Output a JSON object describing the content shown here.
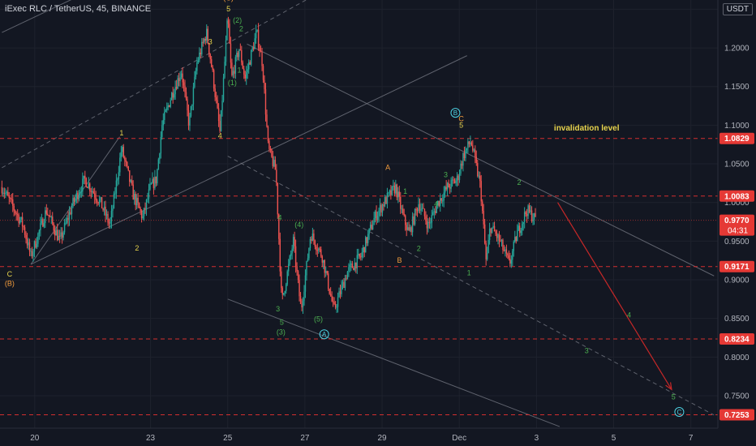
{
  "header": {
    "title": "iExec RLC / TetherUS, 45, BINANCE",
    "currency": "USDT"
  },
  "colors": {
    "background": "#131722",
    "grid": "#1e222d",
    "candle_up": "#26a69a",
    "candle_down": "#ef5350",
    "level_line": "#d32f2f",
    "price_badge": "#e53935",
    "channel_line": "#787b86",
    "arrow": "#c62828",
    "label_orange": "#f39c3d",
    "label_yellow": "#e8d44d",
    "label_green": "#4caf50",
    "label_cyan": "#4dd0e1"
  },
  "chart_data": {
    "type": "candlestick",
    "symbol": "iExec RLC / TetherUS",
    "interval": "45",
    "exchange": "BINANCE",
    "ylim": [
      0.708,
      1.262
    ],
    "y_ticks": [
      1.25,
      1.2,
      1.15,
      1.1,
      1.05,
      1.0,
      0.95,
      0.9,
      0.85,
      0.8,
      0.75
    ],
    "y_tick_labels": [
      "1.2500",
      "1.2000",
      "1.1500",
      "1.1000",
      "1.0500",
      "1.0000",
      "0.9500",
      "0.9000",
      "0.8500",
      "0.8000",
      "0.7500"
    ],
    "x_range_days": [
      -0.9,
      7.7
    ],
    "x_ticks": [
      {
        "day": 0,
        "label": "20"
      },
      {
        "day": 3,
        "label": "23"
      },
      {
        "day": 5,
        "label": "25"
      },
      {
        "day": 7,
        "label": "27"
      },
      {
        "day": 9,
        "label": "29"
      },
      {
        "day": 11,
        "label": "Dec"
      },
      {
        "day": 13,
        "label": "3"
      },
      {
        "day": 15,
        "label": "5"
      },
      {
        "day": 17,
        "label": "7"
      }
    ],
    "price_path": [
      [
        -0.85,
        1.02
      ],
      [
        -0.3,
        0.97
      ],
      [
        -0.1,
        0.93
      ],
      [
        0.3,
        0.99
      ],
      [
        0.65,
        0.95
      ],
      [
        1.0,
        1.0
      ],
      [
        1.3,
        1.03
      ],
      [
        1.7,
        1.0
      ],
      [
        1.95,
        0.97
      ],
      [
        2.25,
        1.07
      ],
      [
        2.55,
        1.01
      ],
      [
        2.8,
        0.98
      ],
      [
        3.0,
        1.02
      ],
      [
        3.15,
        1.03
      ],
      [
        3.3,
        1.1
      ],
      [
        3.55,
        1.14
      ],
      [
        3.8,
        1.17
      ],
      [
        4.0,
        1.1
      ],
      [
        4.2,
        1.18
      ],
      [
        4.45,
        1.22
      ],
      [
        4.6,
        1.17
      ],
      [
        4.8,
        1.09
      ],
      [
        5.0,
        1.24
      ],
      [
        5.1,
        1.16
      ],
      [
        5.3,
        1.2
      ],
      [
        5.45,
        1.16
      ],
      [
        5.75,
        1.22
      ],
      [
        5.9,
        1.18
      ],
      [
        6.05,
        1.07
      ],
      [
        6.25,
        1.04
      ],
      [
        6.4,
        0.87
      ],
      [
        6.7,
        0.95
      ],
      [
        6.9,
        0.86
      ],
      [
        7.15,
        0.96
      ],
      [
        7.45,
        0.93
      ],
      [
        7.75,
        0.86
      ],
      [
        8.1,
        0.91
      ],
      [
        8.45,
        0.93
      ],
      [
        8.8,
        0.98
      ],
      [
        9.05,
        1.0
      ],
      [
        9.35,
        1.02
      ],
      [
        9.55,
        0.98
      ],
      [
        9.7,
        0.96
      ],
      [
        9.95,
        1.0
      ],
      [
        10.2,
        0.97
      ],
      [
        10.45,
        1.0
      ],
      [
        10.7,
        1.02
      ],
      [
        10.95,
        1.03
      ],
      [
        11.1,
        1.06
      ],
      [
        11.3,
        1.08
      ],
      [
        11.55,
        1.02
      ],
      [
        11.7,
        0.92
      ],
      [
        11.8,
        0.97
      ],
      [
        12.05,
        0.95
      ],
      [
        12.3,
        0.92
      ],
      [
        12.5,
        0.96
      ],
      [
        12.75,
        0.99
      ],
      [
        13.0,
        0.977
      ]
    ],
    "current_price": {
      "value": 0.977,
      "label": "0.9770",
      "countdown": "04:31"
    },
    "levels": [
      {
        "value": 1.0829,
        "label": "1.0829"
      },
      {
        "value": 1.0083,
        "label": "1.0083"
      },
      {
        "value": 0.9171,
        "label": "0.9171"
      },
      {
        "value": 0.8234,
        "label": "0.8234"
      },
      {
        "value": 0.7253,
        "label": "0.7253"
      }
    ],
    "annotations": [
      {
        "text": "invalidation level",
        "day": 14.3,
        "price": 1.093,
        "color": "label_yellow",
        "bold": true
      },
      {
        "text": "(C)",
        "day": 5.02,
        "price": 1.2615,
        "color": "label_orange"
      },
      {
        "text": "5",
        "day": 5.02,
        "price": 1.2475,
        "color": "label_yellow"
      },
      {
        "text": "3",
        "day": 4.55,
        "price": 1.205,
        "color": "label_yellow"
      },
      {
        "text": "4",
        "day": 4.8,
        "price": 1.083,
        "color": "label_yellow"
      },
      {
        "text": "1",
        "day": 2.25,
        "price": 1.087,
        "color": "label_yellow"
      },
      {
        "text": "2",
        "day": 2.65,
        "price": 0.938,
        "color": "label_yellow"
      },
      {
        "text": "C",
        "day": -0.65,
        "price": 0.904,
        "color": "label_yellow"
      },
      {
        "text": "(B)",
        "day": -0.65,
        "price": 0.892,
        "color": "label_orange"
      },
      {
        "text": "(2)",
        "day": 5.25,
        "price": 1.2325,
        "color": "label_green"
      },
      {
        "text": "2",
        "day": 5.35,
        "price": 1.2215,
        "color": "label_green"
      },
      {
        "text": "1",
        "day": 5.3,
        "price": 1.168,
        "color": "label_green"
      },
      {
        "text": "(1)",
        "day": 5.12,
        "price": 1.152,
        "color": "label_green"
      },
      {
        "text": "4",
        "day": 6.35,
        "price": 0.977,
        "color": "label_green"
      },
      {
        "text": "(4)",
        "day": 6.85,
        "price": 0.968,
        "color": "label_green"
      },
      {
        "text": "3",
        "day": 6.3,
        "price": 0.859,
        "color": "label_green"
      },
      {
        "text": "5",
        "day": 6.4,
        "price": 0.842,
        "color": "label_green"
      },
      {
        "text": "(3)",
        "day": 6.38,
        "price": 0.829,
        "color": "label_green"
      },
      {
        "text": "(5)",
        "day": 7.35,
        "price": 0.846,
        "color": "label_green"
      },
      {
        "text": "A",
        "day": 9.15,
        "price": 1.042,
        "color": "label_orange"
      },
      {
        "text": "B",
        "day": 9.45,
        "price": 0.922,
        "color": "label_orange"
      },
      {
        "text": "1",
        "day": 9.6,
        "price": 1.011,
        "color": "label_green"
      },
      {
        "text": "2",
        "day": 9.95,
        "price": 0.937,
        "color": "label_green"
      },
      {
        "text": "3",
        "day": 10.65,
        "price": 1.033,
        "color": "label_green"
      },
      {
        "text": "4",
        "day": 10.4,
        "price": 0.995,
        "color": "label_green"
      },
      {
        "text": "5",
        "day": 11.05,
        "price": 1.097,
        "color": "label_yellow"
      },
      {
        "text": "C",
        "day": 11.05,
        "price": 1.105,
        "color": "label_orange"
      },
      {
        "text": "2",
        "day": 12.55,
        "price": 1.023,
        "color": "label_green"
      },
      {
        "text": "1",
        "day": 11.25,
        "price": 0.906,
        "color": "label_green"
      },
      {
        "text": "4",
        "day": 15.4,
        "price": 0.851,
        "color": "label_green"
      },
      {
        "text": "3",
        "day": 14.3,
        "price": 0.805,
        "color": "label_green"
      },
      {
        "text": "5",
        "day": 16.55,
        "price": 0.745,
        "color": "label_green"
      }
    ],
    "circled_labels": [
      {
        "text": "A",
        "day": 7.5,
        "price": 0.8295,
        "color": "label_cyan"
      },
      {
        "text": "B",
        "day": 10.9,
        "price": 1.116,
        "color": "label_cyan"
      },
      {
        "text": "C",
        "day": 16.7,
        "price": 0.729,
        "color": "label_cyan"
      }
    ],
    "trendlines": [
      {
        "from": [
          -0.85,
          1.22
        ],
        "to": [
          1.9,
          1.285
        ],
        "style": "solid"
      },
      {
        "from": [
          -0.85,
          1.045
        ],
        "to": [
          7.5,
          1.275
        ],
        "style": "dashed"
      },
      {
        "from": [
          -0.1,
          0.92
        ],
        "to": [
          2.2,
          1.085
        ],
        "style": "solid"
      },
      {
        "from": [
          -0.1,
          0.92
        ],
        "to": [
          11.2,
          1.19
        ],
        "style": "solid"
      },
      {
        "from": [
          5.5,
          1.205
        ],
        "to": [
          17.6,
          0.905
        ],
        "style": "solid"
      },
      {
        "from": [
          5.0,
          1.06
        ],
        "to": [
          17.6,
          0.725
        ],
        "style": "dashed"
      },
      {
        "from": [
          5.0,
          0.875
        ],
        "to": [
          13.6,
          0.71
        ],
        "style": "solid"
      }
    ],
    "projection_arrow": {
      "from": [
        13.55,
        1.0
      ],
      "to": [
        16.5,
        0.758
      ]
    }
  }
}
